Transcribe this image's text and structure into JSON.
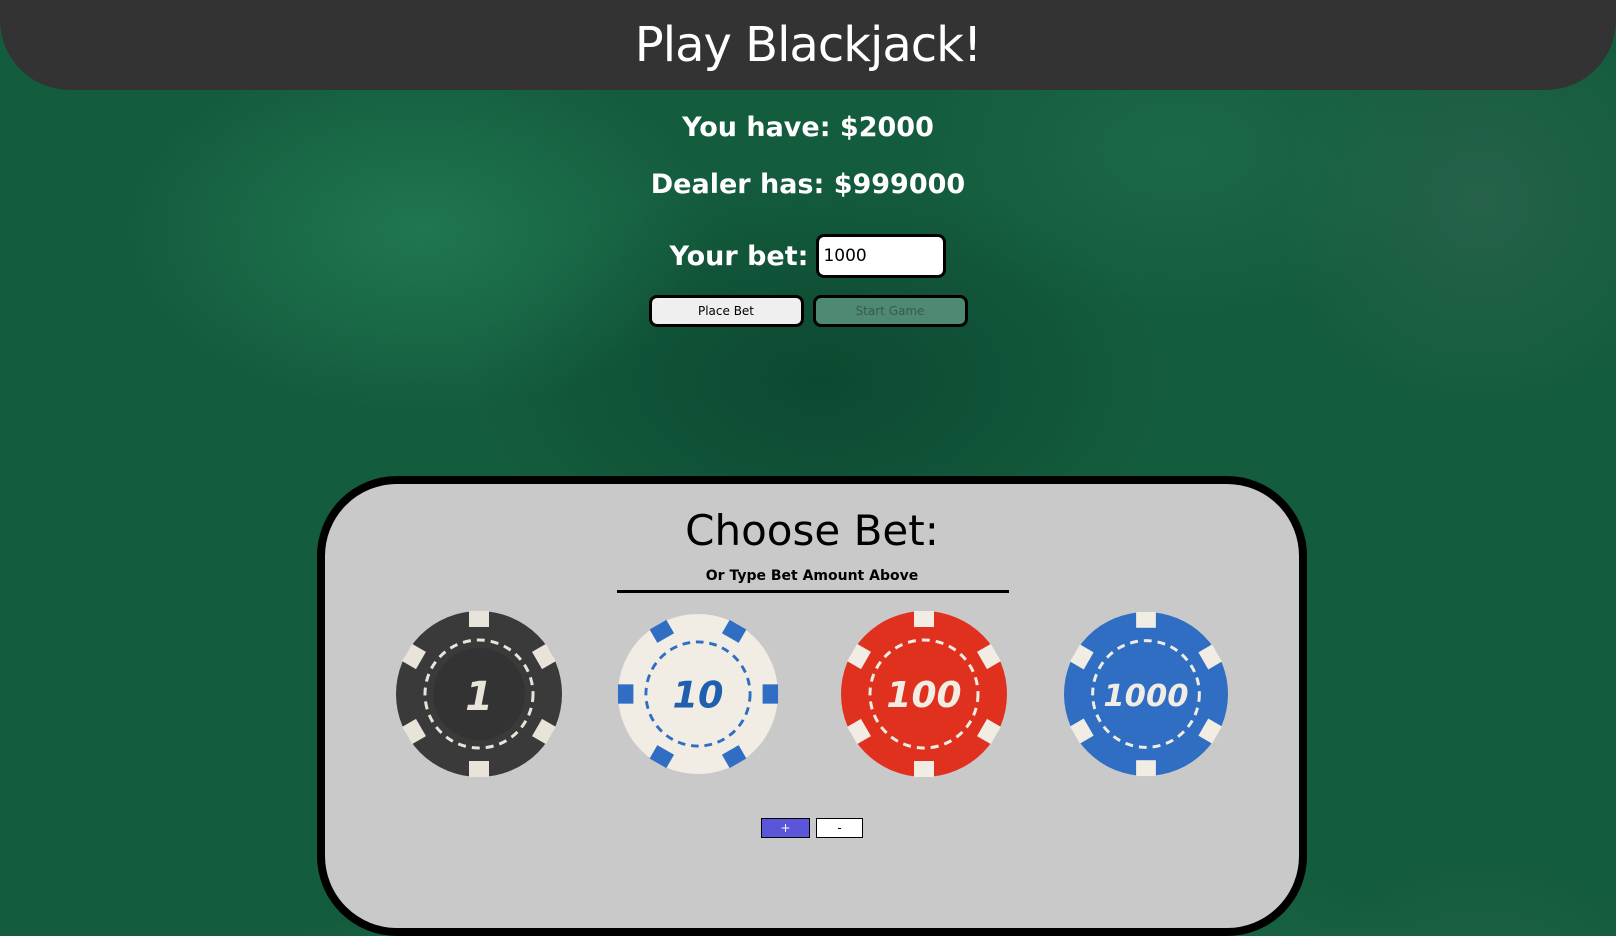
{
  "header": {
    "title": "Play Blackjack!"
  },
  "balances": {
    "player": "You have: $2000",
    "dealer": "Dealer has: $999000"
  },
  "bet": {
    "label": "Your bet:",
    "value": "1000"
  },
  "buttons": {
    "place_bet": "Place Bet",
    "start_game": "Start Game"
  },
  "chooser": {
    "title": "Choose Bet:",
    "subtitle": "Or Type Bet Amount Above",
    "chips": [
      {
        "label": "1",
        "color": "#3a3a3a"
      },
      {
        "label": "10",
        "color": "#f1ede4"
      },
      {
        "label": "100",
        "color": "#e0311f"
      },
      {
        "label": "1000",
        "color": "#2f6ec2"
      }
    ],
    "plus_label": "+",
    "minus_label": "-",
    "plus_color": "#5b55d9"
  }
}
